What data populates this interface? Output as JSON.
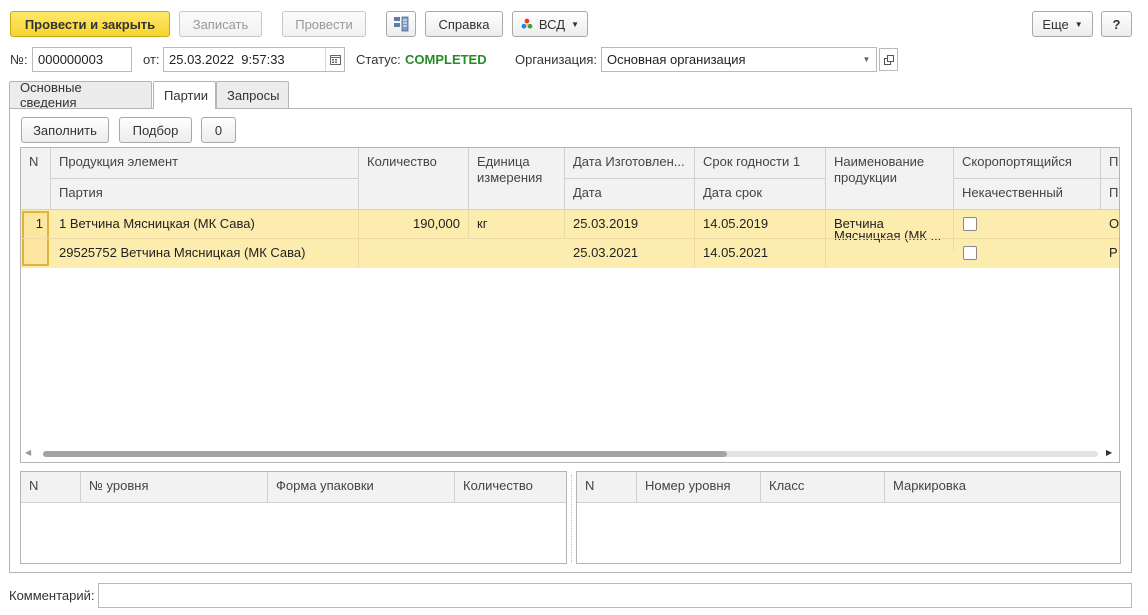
{
  "toolbar": {
    "post_close": "Провести и закрыть",
    "save": "Записать",
    "post": "Провести",
    "help": "Справка",
    "vsd": "ВСД",
    "more": "Еще",
    "question": "?"
  },
  "header": {
    "number_label": "№:",
    "number_value": "000000003",
    "date_label": "от:",
    "date_value": "25.03.2022  9:57:33",
    "status_label": "Статус:",
    "status_value": "COMPLETED",
    "org_label": "Организация:",
    "org_value": "Основная организация"
  },
  "tabs": [
    "Основные сведения",
    "Партии",
    "Запросы"
  ],
  "batch_toolbar": {
    "fill": "Заполнить",
    "select": "Подбор",
    "count": "0"
  },
  "main_table": {
    "headers": {
      "n": "N",
      "product_element": "Продукция элемент",
      "batch": "Партия",
      "quantity": "Количество",
      "unit": "Единица измерения",
      "production_date": "Дата Изготовлен...",
      "date": "Дата",
      "shelf_life": "Срок годности 1",
      "date_term": "Дата срок",
      "product_name": "Наименование продукции",
      "perishable": "Скоропортящийся",
      "defective": "Некачественный",
      "extra1": "Пр",
      "extra2": "Пр"
    },
    "rows": [
      {
        "n": "1",
        "product_element": "1 Ветчина Мясницкая (МК Сава)",
        "batch": "29525752 Ветчина Мясницкая (МК Сава)",
        "quantity": "190,000",
        "unit": "кг",
        "production_date": "25.03.2019",
        "date": "25.03.2021",
        "shelf_life": "14.05.2019",
        "date_term": "14.05.2021",
        "product_name_1": "Ветчина",
        "product_name_2": "Мясницкая (МК ...",
        "extra1": "О",
        "extra2": "Р"
      }
    ]
  },
  "levels_table": {
    "headers": [
      "N",
      "№ уровня",
      "Форма упаковки",
      "Количество"
    ]
  },
  "marks_table": {
    "headers": [
      "N",
      "Номер уровня",
      "Класс",
      "Маркировка"
    ]
  },
  "footer": {
    "comment_label": "Комментарий:",
    "comment_value": ""
  },
  "colors": {
    "primary_button": "#f5d430",
    "status": "#2a8a2a",
    "row_highlight": "#fcecad"
  },
  "icons": [
    "structure-icon",
    "vsd-logo-icon",
    "calendar-icon",
    "dropdown-arrow-icon",
    "open-icon"
  ]
}
